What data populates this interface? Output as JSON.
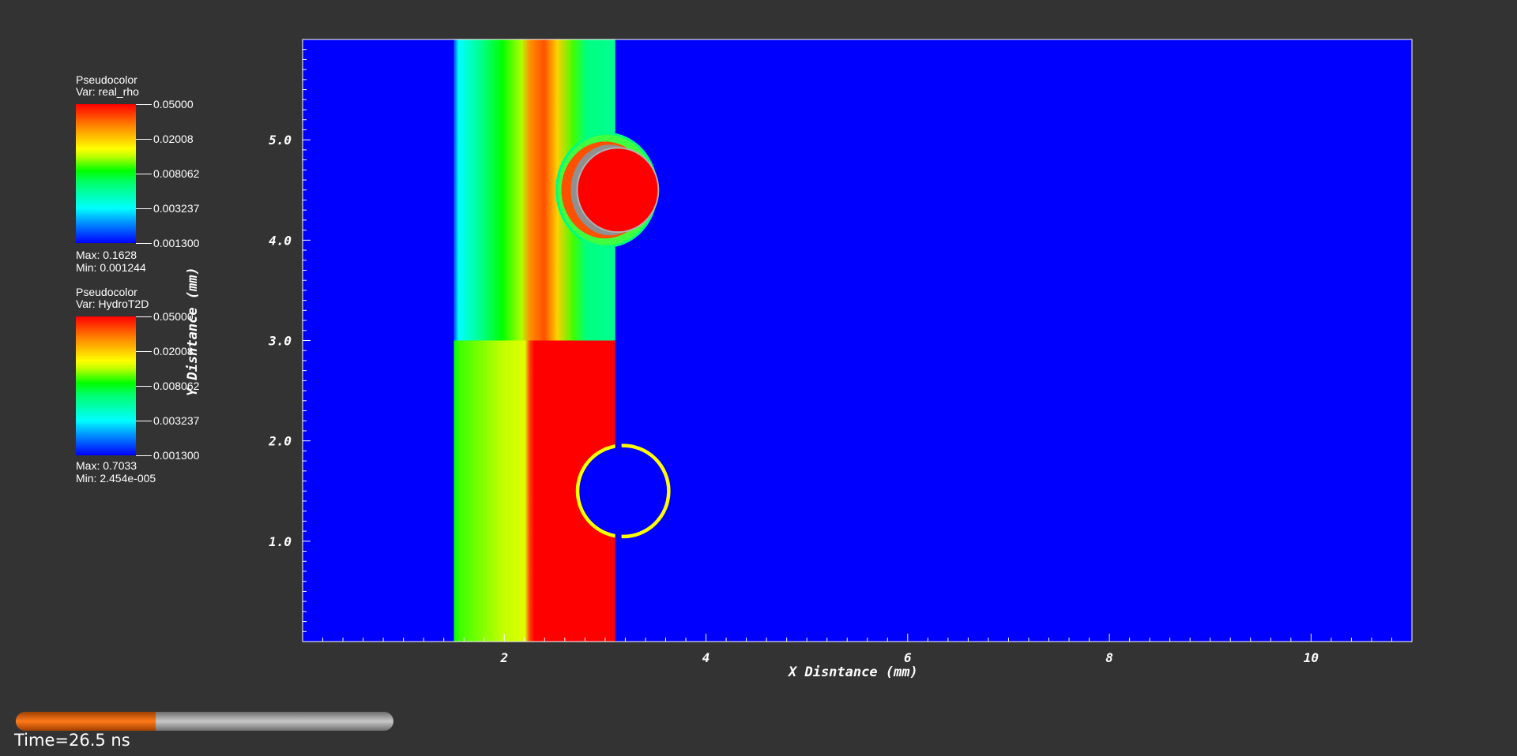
{
  "chart_data": {
    "type": "heatmap",
    "title": "",
    "xlabel": "X Disntance (mm)",
    "ylabel": "Y Disntance (mm)",
    "xlim": [
      0,
      11
    ],
    "ylim": [
      0,
      6
    ],
    "x_ticks": [
      "2",
      "4",
      "6",
      "8",
      "10"
    ],
    "y_ticks": [
      "1.0",
      "2.0",
      "3.0",
      "4.0",
      "5.0"
    ],
    "colormap": [
      "#0000ff",
      "#00ffff",
      "#00ff00",
      "#ffff00",
      "#ff0000"
    ],
    "background_color": "#0000ff",
    "grid": false,
    "regions": {
      "upper_band_x_range": [
        1.5,
        3.1
      ],
      "upper_band_y_range": [
        3.0,
        6.0
      ],
      "lower_band_x_range": [
        1.5,
        3.1
      ],
      "lower_band_y_range": [
        0.0,
        3.0
      ],
      "bubble_center": [
        3.0,
        4.5
      ],
      "bubble_radius": 0.45,
      "cavity_center": [
        3.1,
        1.5
      ],
      "cavity_radius": 0.45
    }
  },
  "legends": [
    {
      "title": "Pseudocolor",
      "var": "Var: real_rho",
      "tick_labels": [
        "0.05000",
        "0.02008",
        "0.008062",
        "0.003237",
        "0.001300"
      ],
      "max": "Max:  0.1628",
      "min": "Min:  0.001244"
    },
    {
      "title": "Pseudocolor",
      "var": "Var: HydroT2D",
      "tick_labels": [
        "0.05000",
        "0.02008",
        "0.008062",
        "0.003237",
        "0.001300"
      ],
      "max": "Max:  0.7033",
      "min": "Min:  2.454e-005"
    }
  ],
  "time": {
    "label": "Time=26.5 ns",
    "progress": 0.37,
    "fill_color": "#ff7a1a"
  }
}
